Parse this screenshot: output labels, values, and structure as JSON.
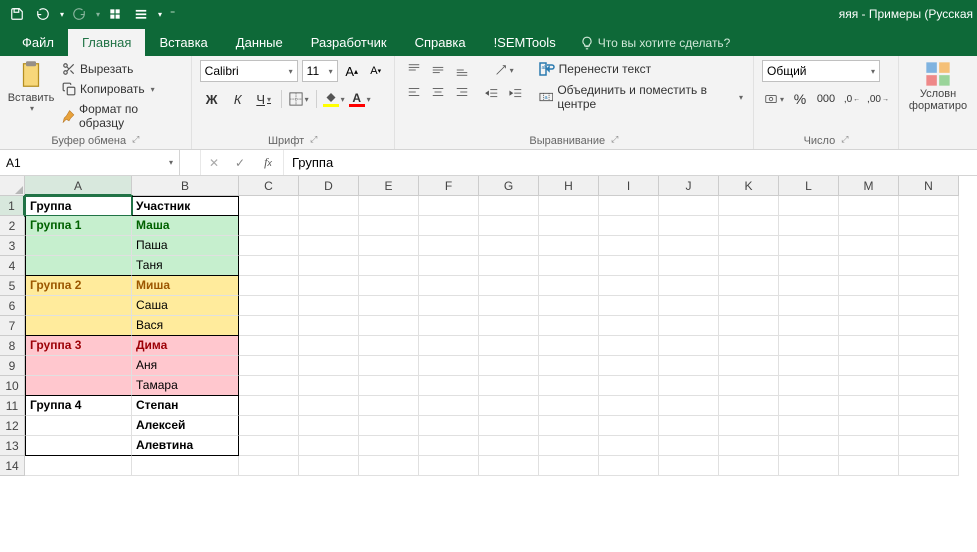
{
  "title": "яяя - Примеры (Русская",
  "tabs": {
    "file": "Файл",
    "home": "Главная",
    "insert": "Вставка",
    "data": "Данные",
    "developer": "Разработчик",
    "help": "Справка",
    "semtools": "!SEMTools",
    "tellme": "Что вы хотите сделать?"
  },
  "ribbon": {
    "clipboard": {
      "label": "Буфер обмена",
      "paste": "Вставить",
      "cut": "Вырезать",
      "copy": "Копировать",
      "format_painter": "Формат по образцу"
    },
    "font": {
      "label": "Шрифт",
      "name": "Calibri",
      "size": "11",
      "bold": "Ж",
      "italic": "К",
      "underline": "Ч"
    },
    "alignment": {
      "label": "Выравнивание",
      "wrap": "Перенести текст",
      "merge": "Объединить и поместить в центре"
    },
    "number": {
      "label": "Число",
      "format": "Общий"
    },
    "cond": {
      "label": "Условн форматиро"
    }
  },
  "fbar": {
    "name": "A1",
    "formula": "Группа"
  },
  "cols": [
    "A",
    "B",
    "C",
    "D",
    "E",
    "F",
    "G",
    "H",
    "I",
    "J",
    "K",
    "L",
    "M",
    "N"
  ],
  "table": {
    "header": {
      "a": "Группа",
      "b": "Участник"
    },
    "rows": [
      {
        "a": "Группа 1",
        "b": "Маша",
        "fill": "g",
        "txt": "g",
        "sep": false
      },
      {
        "a": "",
        "b": "Паша",
        "fill": "g",
        "txt": "",
        "sep": false
      },
      {
        "a": "",
        "b": "Таня",
        "fill": "g",
        "txt": "",
        "sep": true
      },
      {
        "a": "Группа 2",
        "b": "Миша",
        "fill": "y",
        "txt": "y",
        "sep": false
      },
      {
        "a": "",
        "b": "Саша",
        "fill": "y",
        "txt": "",
        "sep": false
      },
      {
        "a": "",
        "b": "Вася",
        "fill": "y",
        "txt": "",
        "sep": true
      },
      {
        "a": "Группа 3",
        "b": "Дима",
        "fill": "r",
        "txt": "r",
        "sep": false
      },
      {
        "a": "",
        "b": "Аня",
        "fill": "r",
        "txt": "",
        "sep": false
      },
      {
        "a": "",
        "b": "Тамара",
        "fill": "r",
        "txt": "",
        "sep": true
      },
      {
        "a": "Группа 4",
        "b": "Степан",
        "fill": "",
        "txt": "b",
        "sep": false
      },
      {
        "a": "",
        "b": "Алексей",
        "fill": "",
        "txt": "b",
        "sep": false
      },
      {
        "a": "",
        "b": "Алевтина",
        "fill": "",
        "txt": "b",
        "sep": true
      }
    ]
  },
  "blank_rows": 1
}
